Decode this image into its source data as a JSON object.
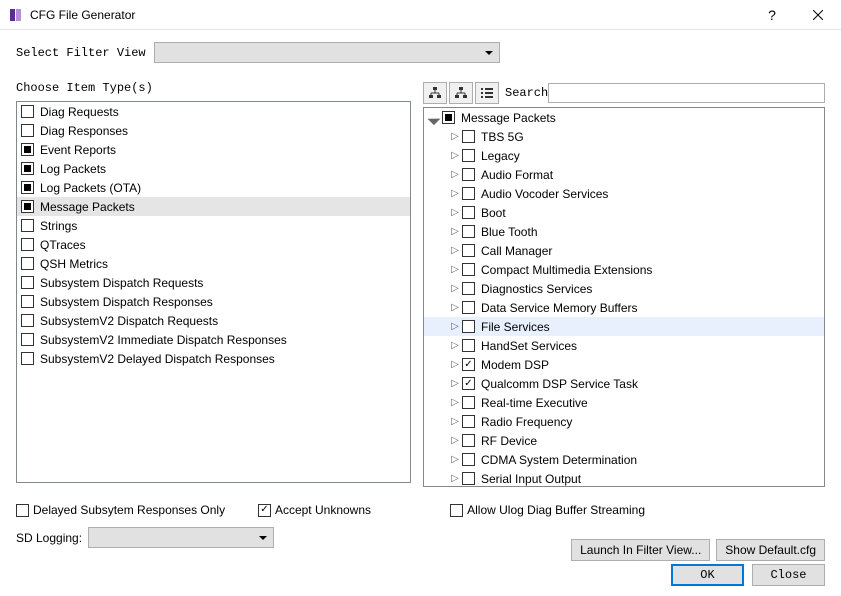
{
  "title": "CFG File Generator",
  "filter_label": "Select Filter View",
  "choose_label": "Choose Item Type(s)",
  "item_types": [
    {
      "label": "Diag Requests",
      "state": "unchecked",
      "selected": false
    },
    {
      "label": "Diag Responses",
      "state": "unchecked",
      "selected": false
    },
    {
      "label": "Event Reports",
      "state": "partial",
      "selected": false
    },
    {
      "label": "Log Packets",
      "state": "partial",
      "selected": false
    },
    {
      "label": "Log Packets (OTA)",
      "state": "partial",
      "selected": false
    },
    {
      "label": "Message Packets",
      "state": "partial",
      "selected": true
    },
    {
      "label": "Strings",
      "state": "unchecked",
      "selected": false
    },
    {
      "label": "QTraces",
      "state": "unchecked",
      "selected": false
    },
    {
      "label": "QSH Metrics",
      "state": "unchecked",
      "selected": false
    },
    {
      "label": "Subsystem Dispatch Requests",
      "state": "unchecked",
      "selected": false
    },
    {
      "label": "Subsystem Dispatch Responses",
      "state": "unchecked",
      "selected": false
    },
    {
      "label": "SubsystemV2 Dispatch Requests",
      "state": "unchecked",
      "selected": false
    },
    {
      "label": "SubsystemV2 Immediate Dispatch Responses",
      "state": "unchecked",
      "selected": false
    },
    {
      "label": "SubsystemV2 Delayed Dispatch Responses",
      "state": "unchecked",
      "selected": false
    }
  ],
  "search_label": "Search",
  "search_placeholder": "",
  "tree_root": {
    "label": "Message Packets",
    "state": "partial",
    "expanded": true
  },
  "tree_children": [
    {
      "label": "TBS 5G",
      "state": "unchecked",
      "expandable": true,
      "hover": false
    },
    {
      "label": "Legacy",
      "state": "unchecked",
      "expandable": true,
      "hover": false
    },
    {
      "label": "Audio Format",
      "state": "unchecked",
      "expandable": true,
      "hover": false
    },
    {
      "label": "Audio Vocoder Services",
      "state": "unchecked",
      "expandable": true,
      "hover": false
    },
    {
      "label": "Boot",
      "state": "unchecked",
      "expandable": true,
      "hover": false
    },
    {
      "label": "Blue Tooth",
      "state": "unchecked",
      "expandable": true,
      "hover": false
    },
    {
      "label": "Call Manager",
      "state": "unchecked",
      "expandable": true,
      "hover": false
    },
    {
      "label": "Compact Multimedia Extensions",
      "state": "unchecked",
      "expandable": true,
      "hover": false
    },
    {
      "label": "Diagnostics Services",
      "state": "unchecked",
      "expandable": true,
      "hover": false
    },
    {
      "label": "Data Service Memory Buffers",
      "state": "unchecked",
      "expandable": true,
      "hover": false
    },
    {
      "label": "File Services",
      "state": "unchecked",
      "expandable": true,
      "hover": true
    },
    {
      "label": "HandSet Services",
      "state": "unchecked",
      "expandable": true,
      "hover": false
    },
    {
      "label": "Modem DSP",
      "state": "checked",
      "expandable": true,
      "hover": false
    },
    {
      "label": "Qualcomm DSP Service Task",
      "state": "checked",
      "expandable": true,
      "hover": false
    },
    {
      "label": "Real-time Executive",
      "state": "unchecked",
      "expandable": true,
      "hover": false
    },
    {
      "label": "Radio Frequency",
      "state": "unchecked",
      "expandable": true,
      "hover": false
    },
    {
      "label": "RF Device",
      "state": "unchecked",
      "expandable": true,
      "hover": false
    },
    {
      "label": "CDMA System Determination",
      "state": "unchecked",
      "expandable": true,
      "hover": false
    },
    {
      "label": "Serial Input Output",
      "state": "unchecked",
      "expandable": true,
      "hover": false
    }
  ],
  "bottom": {
    "delayed": "Delayed Subsytem Responses Only",
    "delayed_checked": false,
    "accept": "Accept Unknowns",
    "accept_checked": true,
    "allow_ulog": "Allow Ulog Diag Buffer Streaming",
    "allow_ulog_checked": false
  },
  "sd_label": "SD Logging:",
  "launch_btn": "Launch In Filter View...",
  "show_default_btn": "Show Default.cfg",
  "ok_btn": "OK",
  "close_btn": "Close"
}
